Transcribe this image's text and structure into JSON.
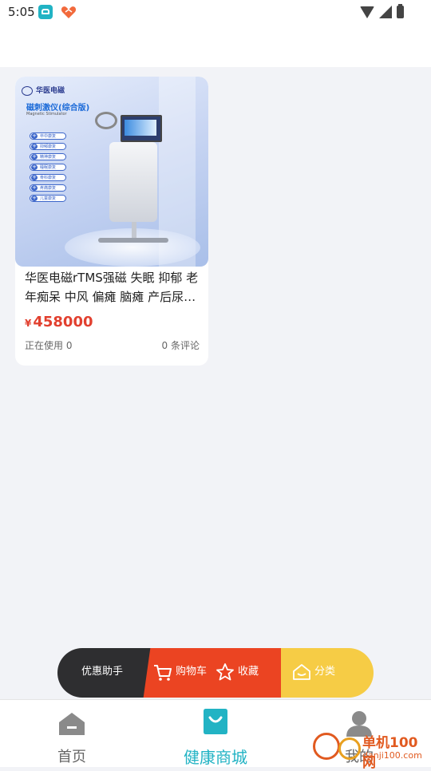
{
  "status_bar": {
    "time": "5:05",
    "icons": [
      "app-icon",
      "heart-app-icon",
      "wifi-icon",
      "signal-icon",
      "battery-icon"
    ]
  },
  "product": {
    "image": {
      "brand": "华医电磁",
      "title": "磁刺激仪(综合版)",
      "subtitle": "Magnetic Stimulator",
      "features": [
        "卒中康复",
        "抑郁康复",
        "精神康复",
        "睡眠康复",
        "骨科康复",
        "疼痛康复",
        "儿童康复"
      ]
    },
    "name": "华医电磁rTMS强磁 失眠 抑郁 老年痴呆 中风 偏瘫 脑瘫 产后尿…",
    "currency": "¥",
    "price": "458000",
    "in_use": "正在使用 0",
    "reviews": "0 条评论"
  },
  "action_bar": {
    "coupon_label": "优惠助手",
    "cart_label": "购物车",
    "favorite_label": "收藏",
    "category_label": "分类"
  },
  "tabbar": {
    "tabs": [
      {
        "label": "首页",
        "icon": "home-icon",
        "active": false
      },
      {
        "label": "健康商城",
        "icon": "shopping-bag-icon",
        "active": true
      },
      {
        "label": "我的",
        "icon": "user-icon",
        "active": false
      }
    ]
  },
  "watermark": {
    "line1": "单机100网",
    "line2": "danji100.com"
  },
  "colors": {
    "accent": "#22b3c4",
    "price": "#e2402f",
    "fab_dark": "#2e2e30",
    "fab_red": "#eb4422",
    "fab_yellow": "#f6cc45"
  }
}
